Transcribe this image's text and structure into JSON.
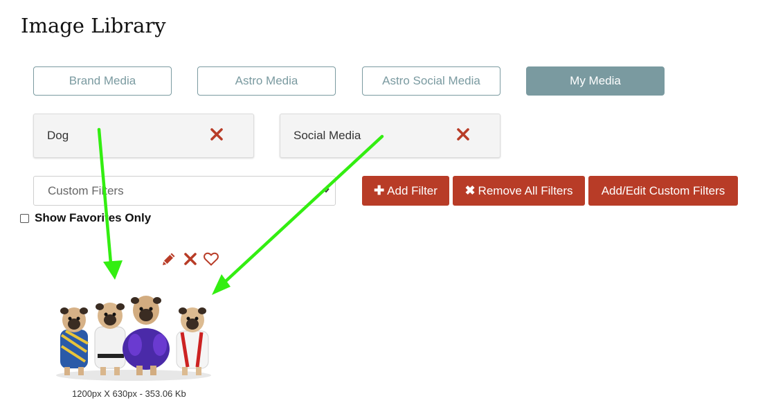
{
  "header": {
    "title": "Image Library"
  },
  "tabs": [
    {
      "label": "Brand Media",
      "active": false
    },
    {
      "label": "Astro Media",
      "active": false
    },
    {
      "label": "Astro Social Media",
      "active": false
    },
    {
      "label": "My Media",
      "active": true
    }
  ],
  "filters": {
    "active": [
      {
        "label": "Dog",
        "remove_icon": "close-icon"
      },
      {
        "label": "Social Media",
        "remove_icon": "close-icon"
      }
    ],
    "custom_select": {
      "value": "Custom Filters"
    },
    "buttons": {
      "add": {
        "icon": "plus-icon",
        "label": "Add Filter"
      },
      "remove_all": {
        "icon": "close-icon",
        "label": "Remove All Filters"
      },
      "custom": {
        "label": "Add/Edit Custom Filters"
      }
    }
  },
  "favorites": {
    "label": "Show Favorites Only",
    "checked": false
  },
  "gallery": [
    {
      "image": "pug-puppies-in-costumes",
      "actions": [
        "pencil-icon",
        "close-icon",
        "heart-icon"
      ],
      "caption": "1200px X 630px - 353.06 Kb"
    }
  ],
  "colors": {
    "accent_red": "#b83c27",
    "tab_border": "#7a9aa0",
    "annotation_arrow": "#33ee11"
  }
}
